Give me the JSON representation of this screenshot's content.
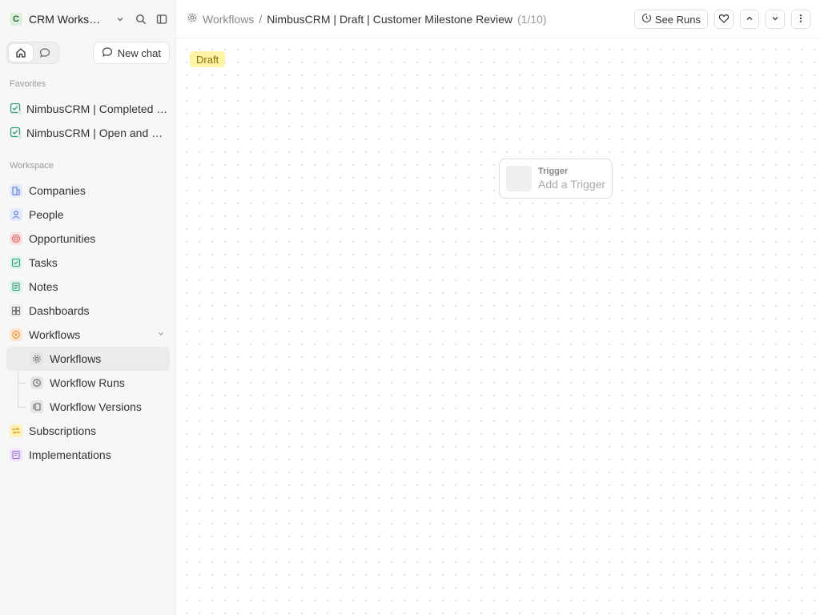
{
  "workspace": {
    "initial": "C",
    "name": "CRM Workspace"
  },
  "sidebar": {
    "new_chat_label": "New chat",
    "favorites_label": "Favorites",
    "favorites": [
      {
        "label": "NimbusCRM | Completed Tasks",
        "icon": "task-list-icon"
      },
      {
        "label": "NimbusCRM | Open and Overdue Tasks",
        "icon": "task-list-icon"
      }
    ],
    "workspace_label": "Workspace",
    "items": [
      {
        "label": "Companies",
        "icon": "building-icon",
        "color": "#5b7bd6"
      },
      {
        "label": "People",
        "icon": "person-icon",
        "color": "#5b7bd6"
      },
      {
        "label": "Opportunities",
        "icon": "target-icon",
        "color": "#e05a5a"
      },
      {
        "label": "Tasks",
        "icon": "checkbox-icon",
        "color": "#2a9d7a"
      },
      {
        "label": "Notes",
        "icon": "note-icon",
        "color": "#2a9d7a"
      },
      {
        "label": "Dashboards",
        "icon": "grid-icon",
        "color": "#777777"
      },
      {
        "label": "Workflows",
        "icon": "workflow-icon",
        "color": "#f08c2e"
      }
    ],
    "workflow_sub": [
      {
        "label": "Workflows",
        "icon": "gear-icon"
      },
      {
        "label": "Workflow Runs",
        "icon": "history-icon"
      },
      {
        "label": "Workflow Versions",
        "icon": "versions-icon"
      }
    ],
    "items_after": [
      {
        "label": "Subscriptions",
        "icon": "repeat-icon",
        "color": "#e0a800"
      },
      {
        "label": "Implementations",
        "icon": "document-icon",
        "color": "#9b6bd6"
      }
    ]
  },
  "topbar": {
    "breadcrumb_root": "Workflows",
    "separator": "/",
    "record_title": "NimbusCRM | Draft | Customer Milestone Review",
    "position": "(1/10)",
    "see_runs_label": "See Runs"
  },
  "canvas": {
    "status_badge": "Draft",
    "trigger_title": "Trigger",
    "trigger_placeholder": "Add a Trigger"
  }
}
